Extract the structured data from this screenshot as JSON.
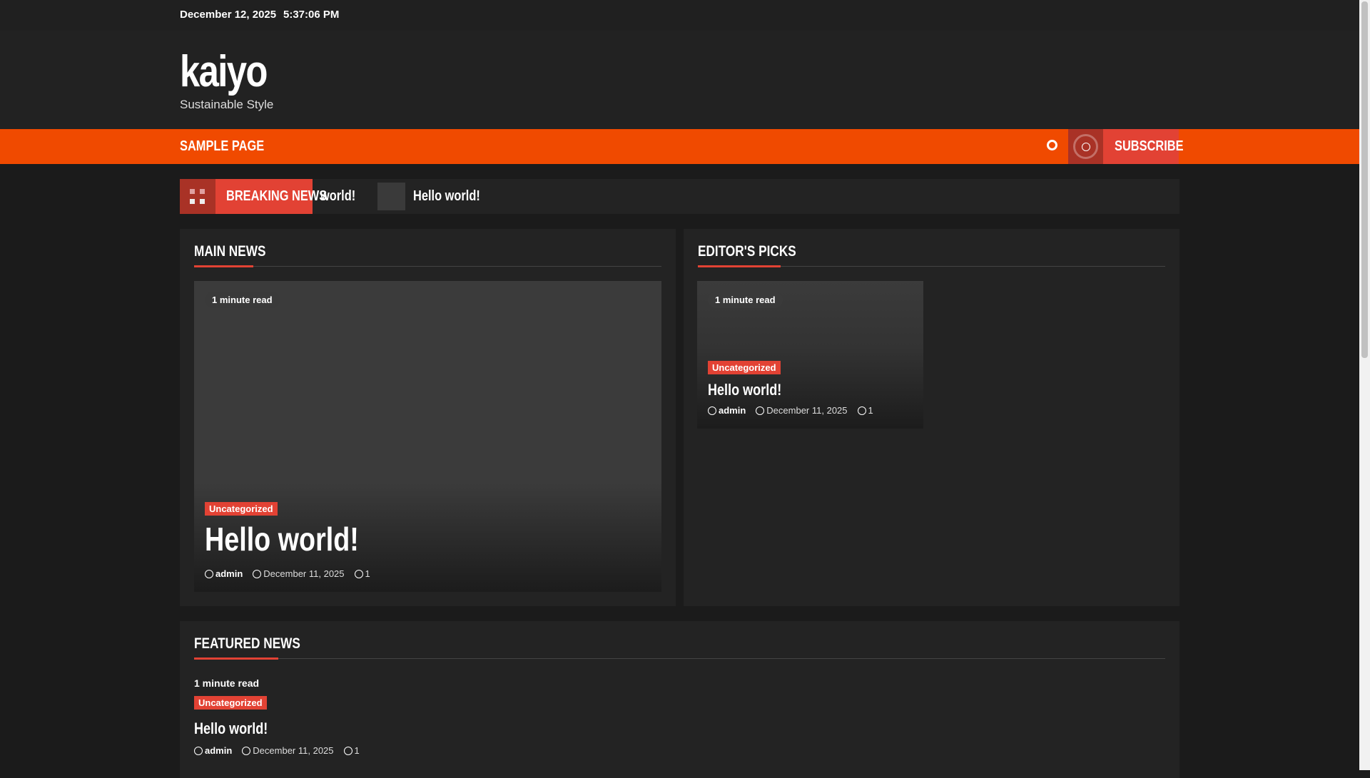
{
  "topbar": {
    "date": "December 12, 2025",
    "time": "5:37:06 PM"
  },
  "site": {
    "title": "kaiyo",
    "tagline": "Sustainable Style"
  },
  "nav": {
    "items": [
      "SAMPLE PAGE"
    ],
    "subscribe": "SUBSCRIBE"
  },
  "breaking": {
    "label": "BREAKING NEWS",
    "ticker": [
      "world!",
      "Hello world!"
    ]
  },
  "main_news": {
    "heading": "MAIN NEWS",
    "post": {
      "read_time": "1 minute read",
      "category": "Uncategorized",
      "title": "Hello world!",
      "author": "admin",
      "date": "December 11, 2025",
      "comments": "1"
    }
  },
  "editors_picks": {
    "heading": "EDITOR'S PICKS",
    "post": {
      "read_time": "1 minute read",
      "category": "Uncategorized",
      "title": "Hello world!",
      "author": "admin",
      "date": "December 11, 2025",
      "comments": "1"
    }
  },
  "featured": {
    "heading": "FEATURED NEWS",
    "post": {
      "read_time": "1 minute read",
      "category": "Uncategorized",
      "title": "Hello world!",
      "author": "admin",
      "date": "December 11, 2025",
      "comments": "1"
    }
  },
  "colors": {
    "accent": "#f04a00",
    "red": "#e24234",
    "dark_red": "#a93226"
  }
}
